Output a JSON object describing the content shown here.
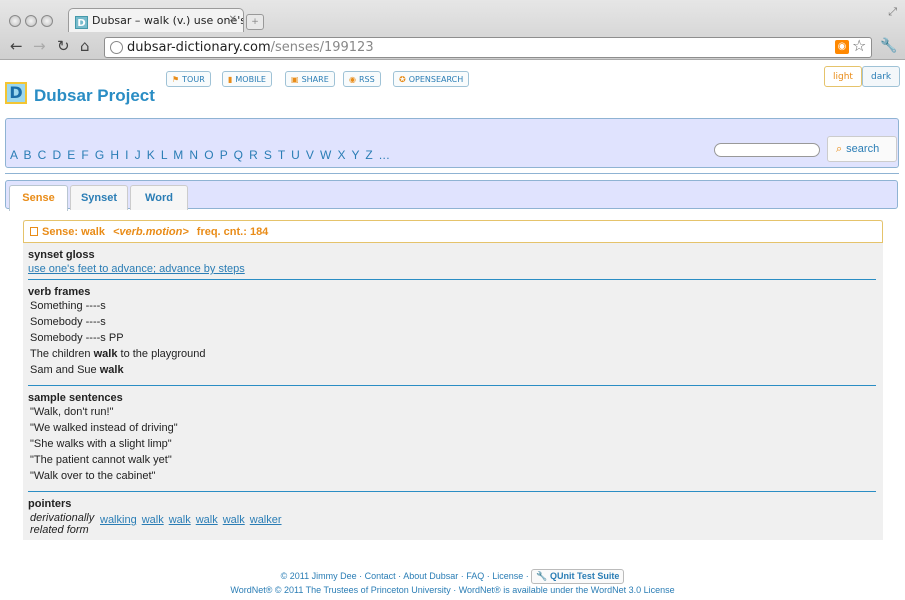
{
  "browser": {
    "tab_title": "Dubsar – walk (v.) use one's",
    "tab_favicon": "D",
    "url_domain": "dubsar-dictionary.com",
    "url_path": "/senses/199123"
  },
  "site": {
    "logo_letter": "D",
    "title": "Dubsar Project",
    "links": [
      {
        "label": "TOUR",
        "icon": "flag-icon"
      },
      {
        "label": "MOBILE",
        "icon": "signal-icon"
      },
      {
        "label": "SHARE",
        "icon": "share-icon"
      },
      {
        "label": "RSS",
        "icon": "rss-icon"
      },
      {
        "label": "OPENSEARCH",
        "icon": "gear-icon"
      }
    ],
    "themes": {
      "light": "light",
      "dark": "dark"
    }
  },
  "alphabet": {
    "letters": [
      "A",
      "B",
      "C",
      "D",
      "E",
      "F",
      "G",
      "H",
      "I",
      "J",
      "K",
      "L",
      "M",
      "N",
      "O",
      "P",
      "Q",
      "R",
      "S",
      "T",
      "U",
      "V",
      "W",
      "X",
      "Y",
      "Z",
      "..."
    ]
  },
  "search": {
    "value": "",
    "button_label": "search"
  },
  "tabs": [
    "Sense",
    "Synset",
    "Word"
  ],
  "sense": {
    "header_prefix": "Sense: walk",
    "pos": "<verb.motion>",
    "freq": "freq. cnt.: 184",
    "gloss_heading": "synset gloss",
    "gloss": "use one's feet to advance; advance by steps",
    "frames_heading": "verb frames",
    "frames": [
      {
        "pre": "Something ----s",
        "bold": "",
        "post": ""
      },
      {
        "pre": "Somebody ----s",
        "bold": "",
        "post": ""
      },
      {
        "pre": "Somebody ----s PP",
        "bold": "",
        "post": ""
      },
      {
        "pre": "The children ",
        "bold": "walk",
        "post": " to the playground"
      },
      {
        "pre": "Sam and Sue ",
        "bold": "walk",
        "post": ""
      }
    ],
    "samples_heading": "sample sentences",
    "samples": [
      "\"Walk, don't run!\"",
      "\"We walked instead of driving\"",
      "\"She walks with a slight limp\"",
      "\"The patient cannot walk yet\"",
      "\"Walk over to the cabinet\""
    ],
    "pointers_heading": "pointers",
    "pointer_label": "derivationally related form",
    "pointer_links": [
      "walking",
      "walk",
      "walk",
      "walk",
      "walk",
      "walker"
    ]
  },
  "footer": {
    "line1": [
      "© 2011 Jimmy Dee",
      "Contact",
      "About Dubsar",
      "FAQ",
      "License"
    ],
    "qunit": "QUnit Test Suite",
    "line2": "WordNet® © 2011 The Trustees of Princeton University · WordNet® is available under the WordNet 3.0 License"
  }
}
